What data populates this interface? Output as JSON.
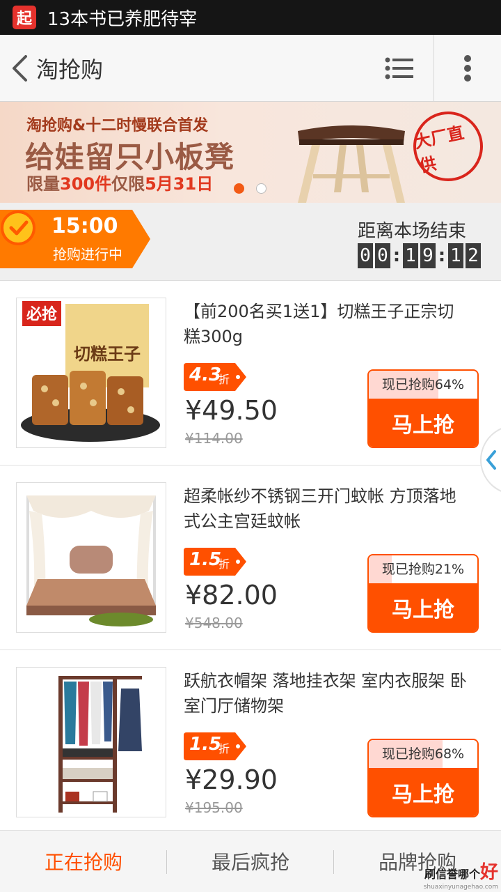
{
  "status_bar": {
    "app_icon_text": "起",
    "notification": "13本书已养肥待宰"
  },
  "nav": {
    "title": "淘抢购"
  },
  "banner": {
    "subtitle": "淘抢购&十二时慢联合首发",
    "title": "给娃留只小板凳",
    "limit_prefix": "限量",
    "limit_qty": "300件",
    "limit_mid": "仅限",
    "limit_date": "5月31日",
    "seal_text": "大厂直供"
  },
  "session": {
    "time": "15:00",
    "status": "抢购进行中",
    "countdown_label": "距离本场结束",
    "countdown": [
      "0",
      "0",
      "1",
      "9",
      "1",
      "2"
    ]
  },
  "products": [
    {
      "title": "【前200名买1送1】切糕王子正宗切糕300g",
      "discount": "4.3",
      "discount_unit": "折",
      "price": "¥49.50",
      "original_price": "¥114.00",
      "sold_text": "现已抢购64%",
      "sold_percent": 64,
      "buy_label": "马上抢",
      "image_icon": "nut-cake-image"
    },
    {
      "title": "超柔帐纱不锈钢三开门蚊帐 方顶落地式公主宫廷蚊帐",
      "discount": "1.5",
      "discount_unit": "折",
      "price": "¥82.00",
      "original_price": "¥548.00",
      "sold_text": "现已抢购21%",
      "sold_percent": 21,
      "buy_label": "马上抢",
      "image_icon": "canopy-bed-image"
    },
    {
      "title": "跃航衣帽架 落地挂衣架 室内衣服架 卧室门厅储物架",
      "discount": "1.5",
      "discount_unit": "折",
      "price": "¥29.90",
      "original_price": "¥195.00",
      "sold_text": "现已抢购68%",
      "sold_percent": 68,
      "buy_label": "马上抢",
      "image_icon": "clothes-rack-image"
    }
  ],
  "tabs": [
    {
      "label": "正在抢购",
      "active": true
    },
    {
      "label": "最后疯抢",
      "active": false
    },
    {
      "label": "品牌抢购",
      "active": false
    }
  ],
  "watermark": {
    "top": "刷信誉哪个",
    "good": "好",
    "url": "shuaxinyunagehao.com"
  },
  "colors": {
    "accent": "#ff5000",
    "statusbar": "#151515"
  }
}
